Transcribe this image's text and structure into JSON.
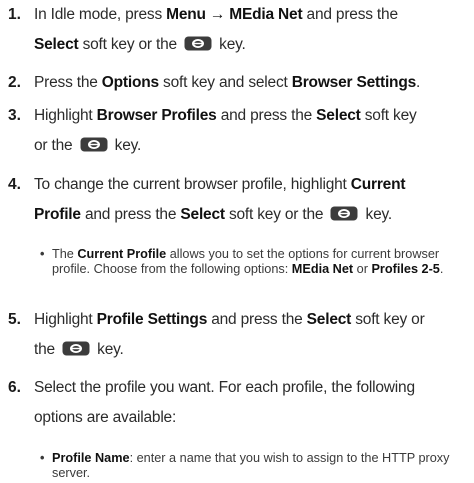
{
  "steps": [
    {
      "num": "1.",
      "l1a": "In Idle mode, press ",
      "l1b": "Menu → MEdia Net",
      "l1c": " and press the",
      "l2a": "Select",
      "l2b": " soft key or the ",
      "l2c": " key."
    },
    {
      "num": "2.",
      "a": "Press the ",
      "b": "Options",
      "c": " soft key and select ",
      "d": "Browser Settings",
      "e": "."
    },
    {
      "num": "3.",
      "l1a": "Highlight ",
      "l1b": "Browser Profiles",
      "l1c": " and press the ",
      "l1d": "Select",
      "l1e": " soft key",
      "l2a": "or the ",
      "l2b": " key."
    },
    {
      "num": "4.",
      "l1a": "To change the current browser profile, highlight ",
      "l1b": "Current",
      "l2a": "Profile",
      "l2b": " and press the ",
      "l2c": "Select",
      "l2d": " soft key or the ",
      "l2e": " key."
    },
    {
      "num": "5.",
      "l1a": "Highlight ",
      "l1b": "Profile Settings",
      "l1c": " and press the ",
      "l1d": "Select",
      "l1e": " soft key or",
      "l2a": "the ",
      "l2b": " key."
    },
    {
      "num": "6.",
      "l1": "Select the profile you want. For each profile, the following",
      "l2": "options are available:"
    }
  ],
  "bullets": [
    {
      "dot": "•",
      "a": "The ",
      "b": "Current Profile",
      "c": " allows you to set the options for current browser profile. Choose from the following options: ",
      "d": "MEdia Net",
      "e": " or ",
      "f": "Profiles 2-5",
      "g": "."
    },
    {
      "dot": "•",
      "a": "Profile Name",
      "b": ": enter a name that you wish to assign to the HTTP proxy server."
    }
  ],
  "icons": {
    "key": "select-key-icon"
  }
}
